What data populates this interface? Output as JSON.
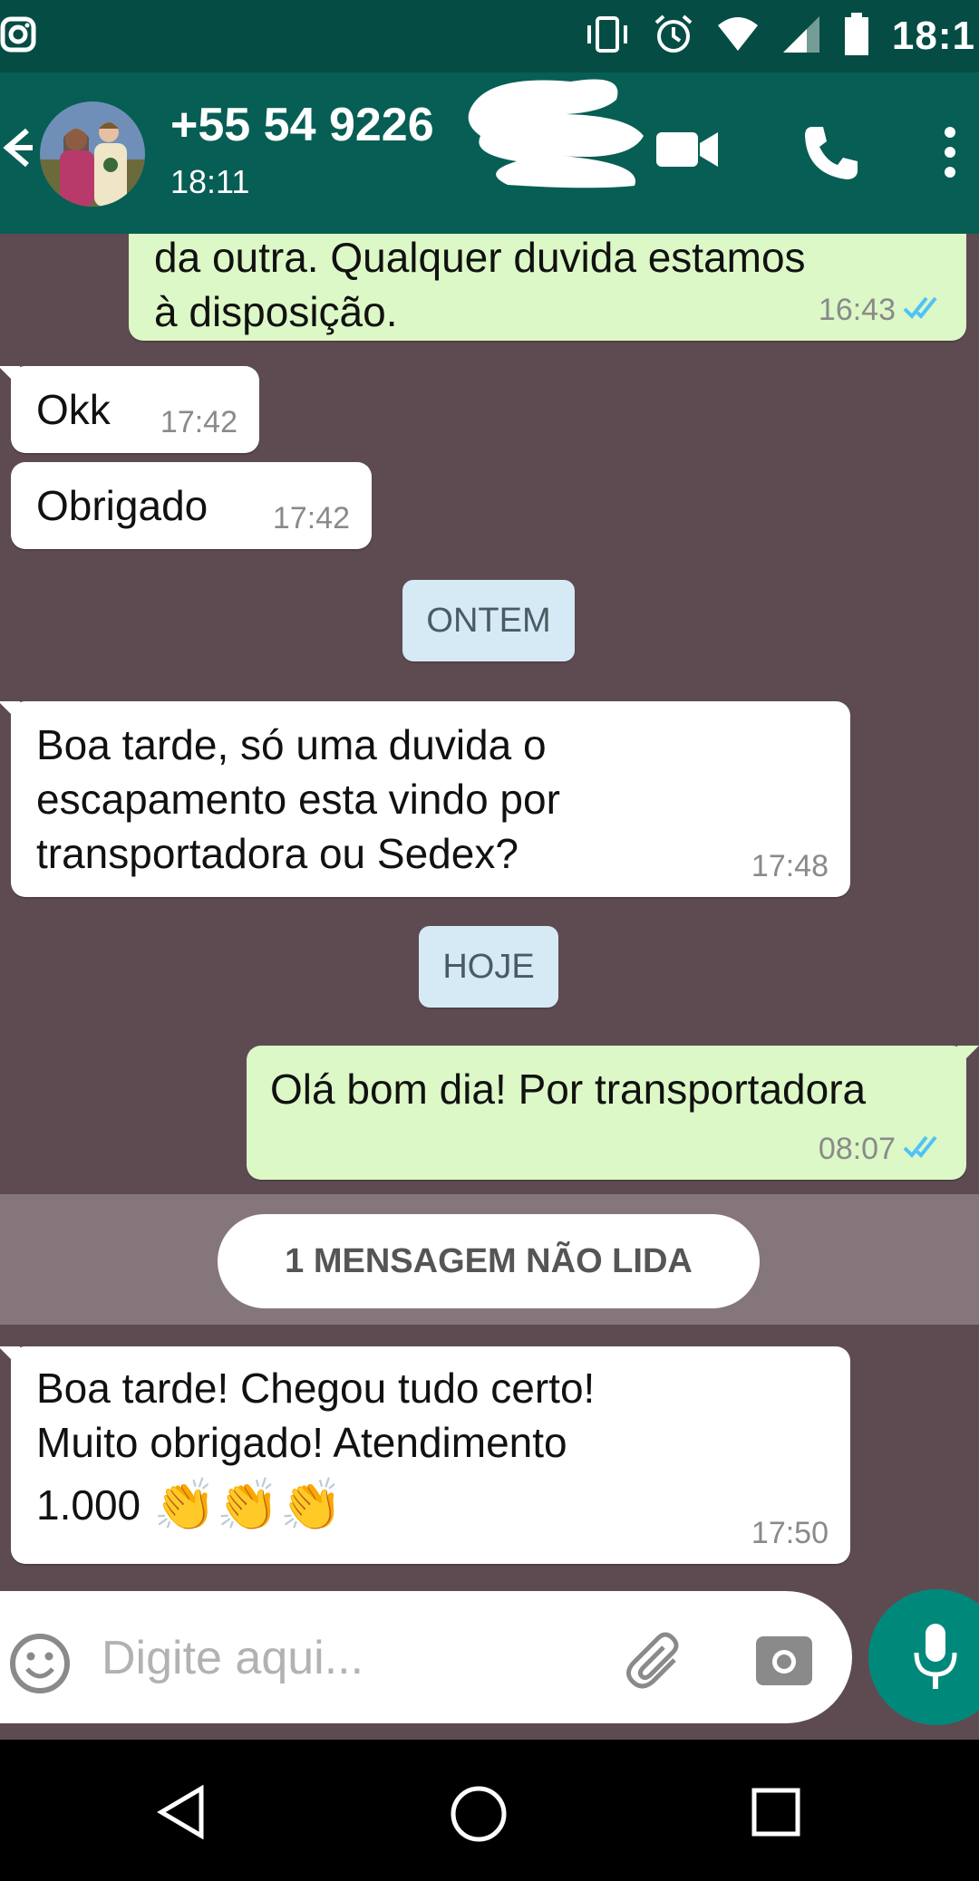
{
  "status_bar": {
    "time": "18:1"
  },
  "header": {
    "contact_number": "+55 54 9226",
    "last_seen": "18:11"
  },
  "messages": [
    {
      "direction": "out",
      "lines": [
        "da outra. Qualquer duvida estamos",
        "à disposição."
      ],
      "time": "16:43",
      "read": true
    },
    {
      "direction": "in",
      "lines": [
        "Okk"
      ],
      "time": "17:42"
    },
    {
      "direction": "in",
      "lines": [
        "Obrigado"
      ],
      "time": "17:42"
    },
    {
      "direction": "in",
      "lines": [
        "Boa tarde, só uma duvida o",
        "escapamento esta vindo por",
        "transportadora ou Sedex?"
      ],
      "time": "17:48"
    },
    {
      "direction": "out",
      "lines": [
        "Olá bom dia! Por transportadora"
      ],
      "time": "08:07",
      "read": true
    },
    {
      "direction": "in",
      "lines": [
        "Boa tarde! Chegou tudo certo!",
        "Muito obrigado! Atendimento",
        "1.000"
      ],
      "emoji": "👏👏👏",
      "time": "17:50"
    }
  ],
  "date_chips": {
    "yesterday": "ONTEM",
    "today": "HOJE"
  },
  "unread_banner": "1 MENSAGEM NÃO LIDA",
  "input": {
    "placeholder": "Digite aqui..."
  },
  "colors": {
    "header": "#075e54",
    "status_bar": "#054d44",
    "outgoing_bubble": "#dcf8c6",
    "chat_bg": "#5e4b52",
    "read_ticks": "#4fc3f7",
    "mic_button": "#00897b"
  },
  "icons": [
    "instagram-icon",
    "vibrate-icon",
    "alarm-icon",
    "wifi-icon",
    "signal-icon",
    "battery-icon",
    "back-arrow-icon",
    "video-call-icon",
    "voice-call-icon",
    "more-options-icon",
    "emoji-icon",
    "attach-icon",
    "camera-icon",
    "mic-icon",
    "nav-back-icon",
    "nav-home-icon",
    "nav-recent-icon"
  ]
}
